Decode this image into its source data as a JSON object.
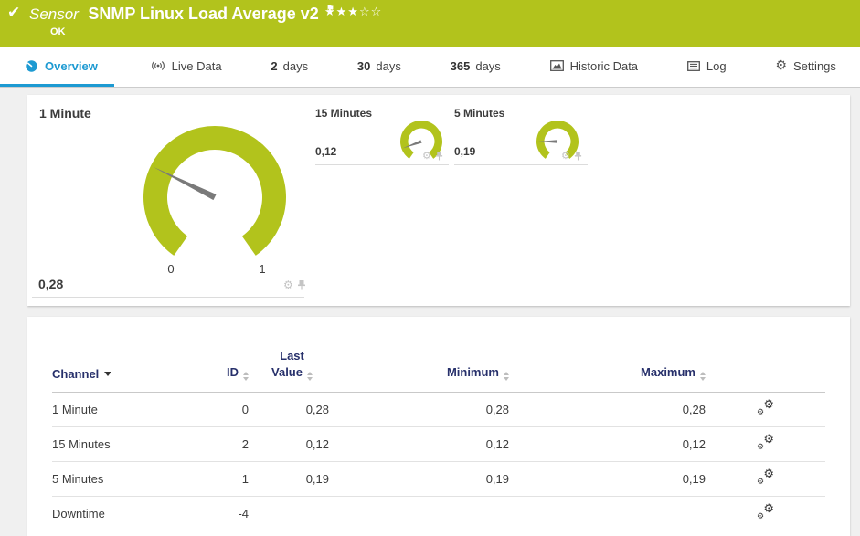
{
  "colors": {
    "green": "#b2c31c",
    "blue": "#1d9ad2",
    "navy": "#27306b",
    "gauge_green": "#b2c31c",
    "needle": "#7a7a7a",
    "icon_gray": "#c4c4c4"
  },
  "header": {
    "kind": "Sensor",
    "title": "SNMP Linux Load Average v2",
    "status": "OK",
    "stars_filled": "★★★",
    "stars_empty": "☆☆"
  },
  "tabs": [
    {
      "label": "Overview",
      "active": true
    },
    {
      "label": "Live Data"
    },
    {
      "num": "2",
      "label": "days"
    },
    {
      "num": "30",
      "label": "days"
    },
    {
      "num": "365",
      "label": "days"
    },
    {
      "label": "Historic Data"
    },
    {
      "label": "Log"
    },
    {
      "label": "Settings"
    }
  ],
  "chart_data": [
    {
      "type": "gauge",
      "title": "1 Minute",
      "value": 0.28,
      "value_label": "0,28",
      "min": 0,
      "max": 1,
      "scale_labels_visible": true
    },
    {
      "type": "gauge",
      "title": "15 Minutes",
      "value": 0.12,
      "value_label": "0,12",
      "min": 0,
      "max": 1,
      "scale_labels_visible": false
    },
    {
      "type": "gauge",
      "title": "5 Minutes",
      "value": 0.19,
      "value_label": "0,19",
      "min": 0,
      "max": 1,
      "scale_labels_visible": false
    }
  ],
  "table": {
    "headers": {
      "channel": "Channel",
      "id": "ID",
      "last": "Last Value",
      "min": "Minimum",
      "max": "Maximum"
    },
    "rows": [
      {
        "channel": "1 Minute",
        "id": "0",
        "last": "0,28",
        "min": "0,28",
        "max": "0,28"
      },
      {
        "channel": "15 Minutes",
        "id": "2",
        "last": "0,12",
        "min": "0,12",
        "max": "0,12"
      },
      {
        "channel": "5 Minutes",
        "id": "1",
        "last": "0,19",
        "min": "0,19",
        "max": "0,19"
      },
      {
        "channel": "Downtime",
        "id": "-4",
        "last": "",
        "min": "",
        "max": ""
      }
    ]
  }
}
